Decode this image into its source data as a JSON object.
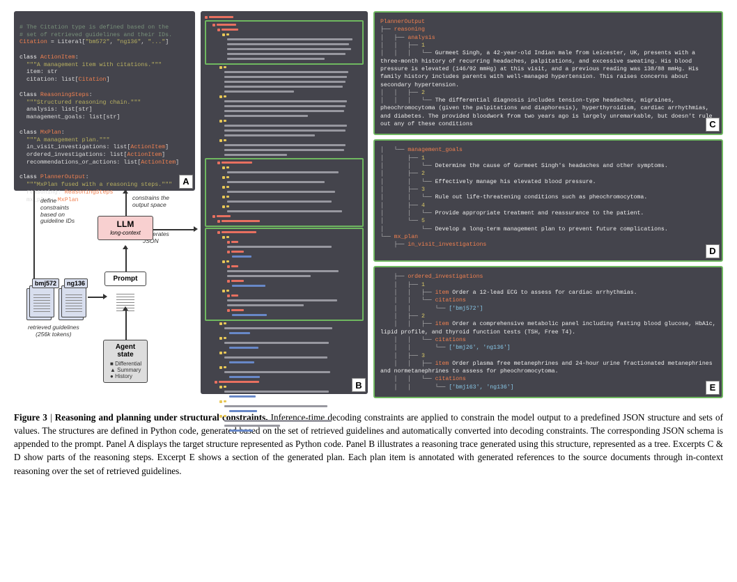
{
  "figure_number": "Figure 3",
  "figure_title": "Reasoning and planning under structural constraints.",
  "caption_body": "Inference-time decoding constraints are applied to constrain the model output to a predefined JSON structure and sets of values. The structures are defined in Python code, generated based on the set of retrieved guidelines and automatically converted into decoding constraints. The corresponding JSON schema is appended to the prompt. Panel A displays the target structure represented as Python code. Panel B illustrates a reasoning trace generated using this structure, represented as a tree. Excerpts C & D show parts of the reasoning steps. Excerpt E shows a section of the generated plan. Each plan item is annotated with generated references to the source documents through in-context reasoning over the set of retrieved guidelines.",
  "panel_labels": {
    "a": "A",
    "b": "B",
    "c": "C",
    "d": "D",
    "e": "E"
  },
  "code_panel": {
    "comment1": "# The Citation type is defined based on the",
    "comment2": "# set of retrieved guidelines and their IDs.",
    "citation_def": "Citation = Literal[\"bm572\", \"ng136\", \"...\"]",
    "class1": {
      "keyword": "class",
      "name": "ActionItem",
      "doc": "\"\"\"A management item with citations.\"\"\"",
      "f1": "item: str",
      "f2": "citation: list[",
      "f2b": "Citation",
      "f2c": "]"
    },
    "class2": {
      "keyword": "Class",
      "name": "ReasoningSteps",
      "doc": "\"\"\"Structured reasoning chain.\"\"\"",
      "f1": "analysis: list[str]",
      "f2": "management_goals: list[str]"
    },
    "class3": {
      "keyword": "class",
      "name": "MxPlan",
      "doc": "\"\"\"A management plan.\"\"\"",
      "f1": "in_visit_investigations: list[",
      "f1b": "ActionItem",
      "f1c": "]",
      "f2": "ordered_investigations: list[",
      "f2b": "ActionItem",
      "f2c": "]",
      "f3": "recommendations_or_actions: list[",
      "f3b": "ActionItem",
      "f3c": "]"
    },
    "class4": {
      "keyword": "class",
      "name": "PlannerOutput",
      "doc": "\"\"\"MxPlan fused with a reasoning steps.\"\"\"",
      "f1": "reasoning: ",
      "f1b": "ReasoningSteps",
      "f2": "mx_plan: ",
      "f2b": "MxPlan"
    }
  },
  "diagram": {
    "define_constraints": "define\nconstraints\nbased on\nguideline IDs",
    "constrains_output": "constrains the\noutput space",
    "generates_json": "generates\nJSON",
    "llm": "LLM",
    "llm_sub": "long-context",
    "prompt": "Prompt",
    "agent_state": "Agent\nstate",
    "agent_items": [
      "Differential",
      "Summary",
      "History"
    ],
    "bmj": "bmj572",
    "ng": "ng136",
    "retrieved": "retrieved guidelines\n(256k tokens)"
  },
  "panel_c": {
    "root": "PlannerOutput",
    "reasoning": "reasoning",
    "analysis": "analysis",
    "n1": "1",
    "text1": "Gurmeet Singh, a 42-year-old Indian male from Leicester, UK, presents with a three-month history of recurring headaches, palpitations, and excessive sweating. His blood pressure is elevated (146/92 mmHg) at this visit, and a previous reading was 138/88 mmHg.  His family history includes parents with well-managed hypertension. This raises concerns about secondary hypertension.",
    "n2": "2",
    "text2": "The differential diagnosis includes tension-type headaches, migraines, pheochromocytoma (given the palpitations and diaphoresis), hyperthyroidism, cardiac arrhythmias, and diabetes.  The provided bloodwork from two years ago is largely unremarkable, but doesn't rule out any of these conditions"
  },
  "panel_d": {
    "management_goals": "management_goals",
    "g1n": "1",
    "g1": "Determine the cause of Gurmeet Singh's headaches and other symptoms.",
    "g2n": "2",
    "g2": "Effectively manage his elevated blood pressure.",
    "g3n": "3",
    "g3": "Rule out life-threatening conditions such as pheochromocytoma.",
    "g4n": "4",
    "g4": "Provide appropriate treatment and reassurance to the patient.",
    "g5n": "5",
    "g5": "Develop a long-term management plan to prevent future complications.",
    "mx_plan": "mx_plan",
    "in_visit": "in_visit_investigations"
  },
  "panel_e": {
    "ordered": "ordered_investigations",
    "n1": "1",
    "item1_kw": "item",
    "item1": "Order a 12-lead ECG to assess for cardiac arrhythmias.",
    "cit_kw": "citations",
    "cit1": "['bmj572']",
    "n2": "2",
    "item2_kw": "item",
    "item2": "Order a comprehensive metabolic panel including fasting blood glucose, HbA1c, lipid profile, and thyroid function tests (TSH, Free T4).",
    "cit2": "['bmj26', 'ng136']",
    "n3": "3",
    "item3_kw": "item",
    "item3": "Order plasma free metanephrines and 24-hour urine fractionated metanephrines and normetanephrines to assess for pheochromocytoma.",
    "cit3": "['bmj163', 'ng136']"
  }
}
